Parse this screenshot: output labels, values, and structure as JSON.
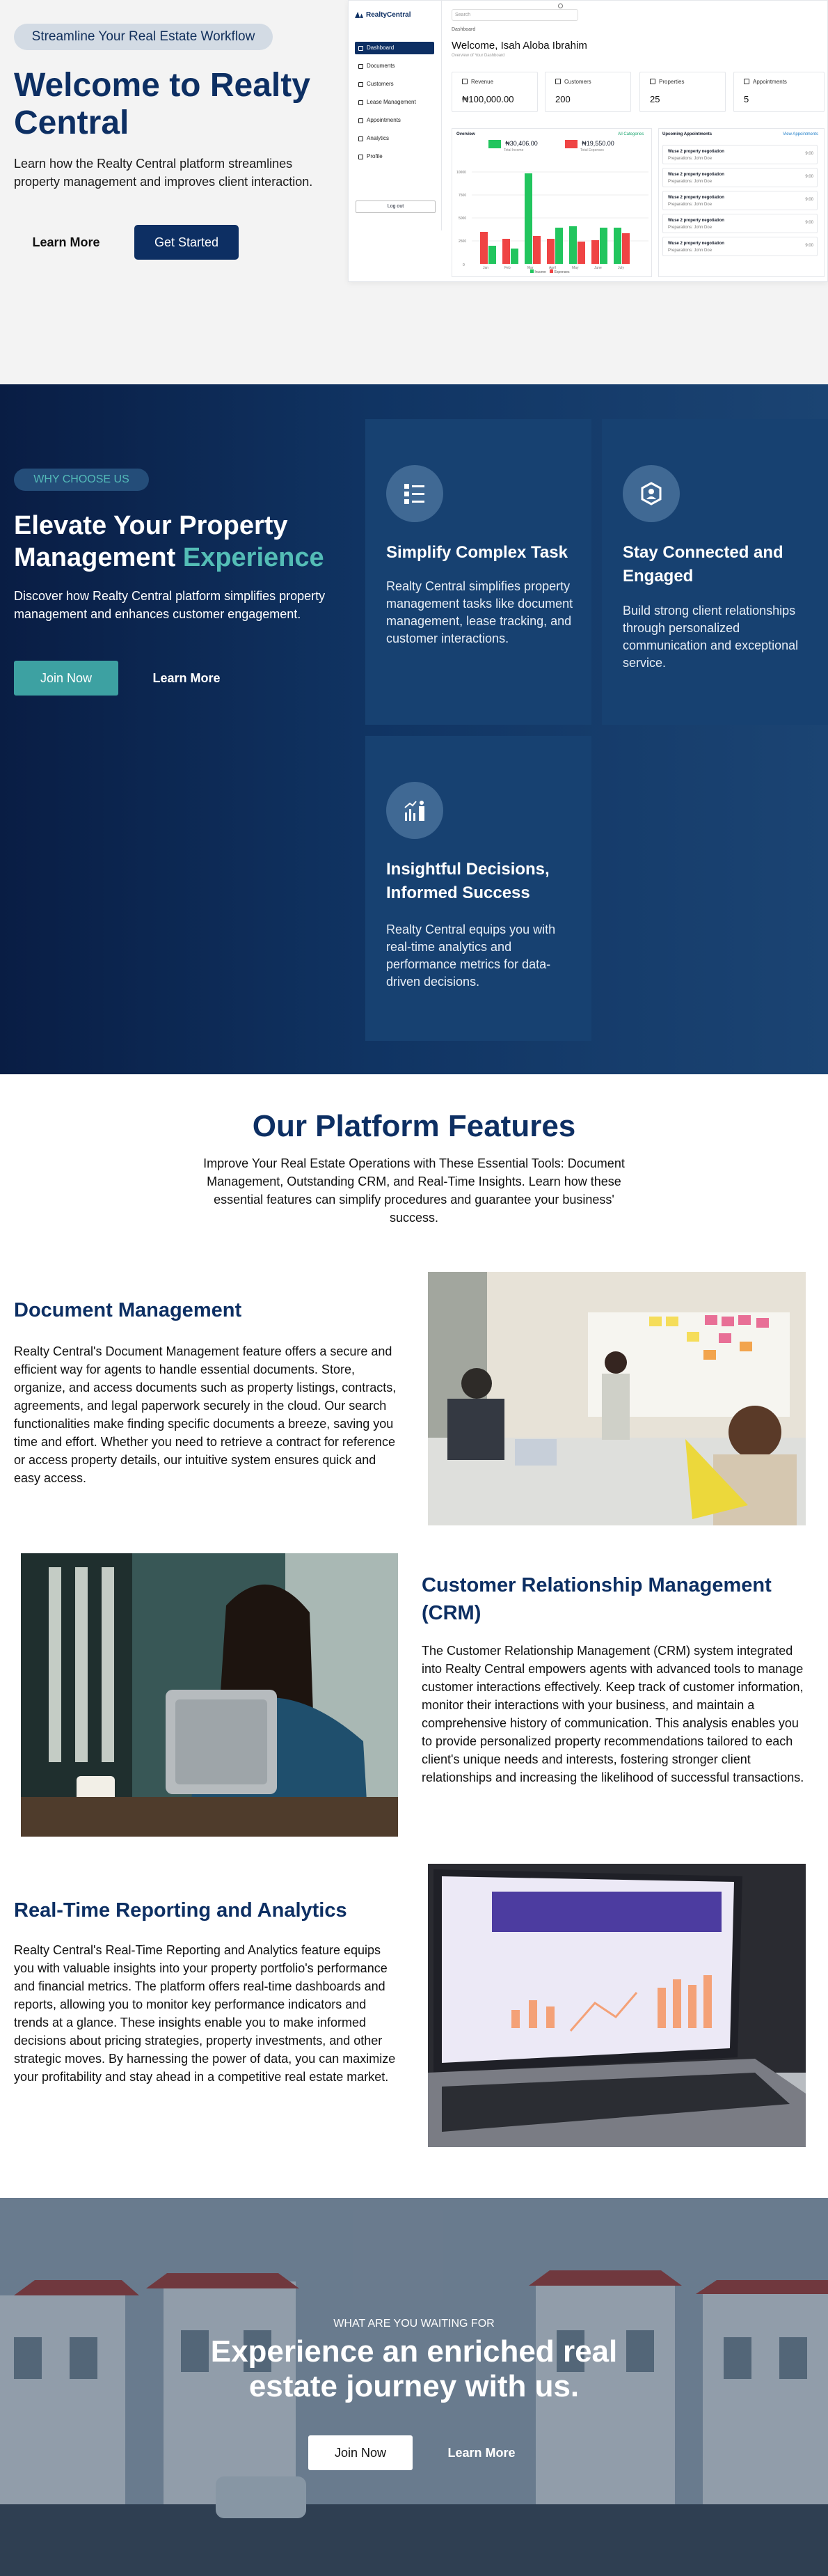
{
  "hero": {
    "badge": "Streamline Your Real Estate Workflow",
    "title": "Welcome to Realty Central",
    "subtitle": "Learn how the Realty Central platform streamlines property management and improves client interaction.",
    "learn_more": "Learn More",
    "get_started": "Get Started"
  },
  "dashboard": {
    "logo": "RealtyCentral",
    "search_placeholder": "Search",
    "nav": [
      "Dashboard",
      "Documents",
      "Customers",
      "Lease Management",
      "Appointments",
      "Analytics",
      "Profile"
    ],
    "logout": "Log out",
    "breadcrumb": "Dashboard",
    "welcome": "Welcome, Isah Aloba Ibrahim",
    "overview_sub": "Overview of Your Dashboard",
    "stats": [
      {
        "label": "Revenue",
        "value": "₦100,000.00"
      },
      {
        "label": "Customers",
        "value": "200"
      },
      {
        "label": "Properties",
        "value": "25"
      },
      {
        "label": "Appointments",
        "value": "5"
      }
    ],
    "chart": {
      "title": "Overview",
      "filter": "All Categories",
      "income_value": "₦30,406.00",
      "income_label": "Total Income",
      "expense_value": "₦19,550.00",
      "expense_label": "Total Expenses",
      "legend": [
        "Income",
        "Expenses"
      ]
    },
    "appointments": {
      "title": "Upcoming Appointments",
      "view_all": "View Appointments",
      "rows": [
        {
          "title": "Wuse 2 property negotiation",
          "who": "Preparations: John Doe",
          "time": "9:00"
        },
        {
          "title": "Wuse 2 property negotiation",
          "who": "Preparations: John Doe",
          "time": "9:00"
        },
        {
          "title": "Wuse 2 property negotiation",
          "who": "Preparations: John Doe",
          "time": "9:00"
        },
        {
          "title": "Wuse 2 property negotiation",
          "who": "Preparations: John Doe",
          "time": "9:00"
        },
        {
          "title": "Wuse 2 property negotiation",
          "who": "Preparations: John Doe",
          "time": "9:00"
        }
      ]
    }
  },
  "why": {
    "badge": "WHY CHOOSE US",
    "title_main": "Elevate Your Property Management",
    "title_accent": "Experience",
    "subtitle": "Discover how Realty Central platform simplifies property management and enhances customer engagement.",
    "join": "Join Now",
    "learn": "Learn More",
    "cards": [
      {
        "title": "Simplify Complex Task",
        "body": "Realty Central simplifies property management tasks like document management, lease tracking, and customer interactions."
      },
      {
        "title": "Stay Connected and Engaged",
        "body": "Build strong client relationships through personalized communication and exceptional service."
      },
      {
        "title": "Insightful Decisions, Informed Success",
        "body": "Realty Central equips you with real-time analytics and performance metrics for data-driven decisions."
      }
    ]
  },
  "features": {
    "title": "Our Platform Features",
    "subtitle": "Improve Your Real Estate Operations with These Essential Tools: Document Management, Outstanding CRM, and Real-Time Insights. Learn how these essential features can simplify procedures and guarantee your business' success.",
    "items": [
      {
        "title": "Document Management",
        "body": "Realty Central's Document Management feature offers a secure and efficient way for agents to handle essential documents. Store, organize, and access documents such as property listings, contracts, agreements, and legal paperwork securely in the cloud. Our search functionalities make finding specific documents a breeze, saving you time and effort. Whether you need to retrieve a contract for reference or access property details, our intuitive system ensures quick and easy access."
      },
      {
        "title": "Customer Relationship Management (CRM)",
        "body": "The Customer Relationship Management (CRM) system integrated into Realty Central empowers agents with advanced tools to manage customer interactions effectively. Keep track of customer information, monitor their interactions with your business, and maintain a comprehensive history of communication. This analysis enables you to provide personalized property recommendations tailored to each client's unique needs and interests, fostering stronger client relationships and increasing the likelihood of successful transactions."
      },
      {
        "title": "Real-Time Reporting and Analytics",
        "body": "Realty Central's Real-Time Reporting and Analytics feature equips you with valuable insights into your property portfolio's performance and financial metrics. The platform offers real-time dashboards and reports, allowing you to monitor key performance indicators and trends at a glance. These insights enable you to make informed decisions about pricing strategies, property investments, and other strategic moves. By harnessing the power of data, you can maximize your profitability and stay ahead in a competitive real estate market."
      }
    ]
  },
  "cta": {
    "small": "WHAT ARE YOU WAITING FOR",
    "title": "Experience an enriched real estate journey with us.",
    "join": "Join Now",
    "learn": "Learn More"
  },
  "colors": {
    "brand": "#0d2f63",
    "accent": "#54bdb6",
    "income": "#22c55e",
    "expense": "#ef4444"
  }
}
